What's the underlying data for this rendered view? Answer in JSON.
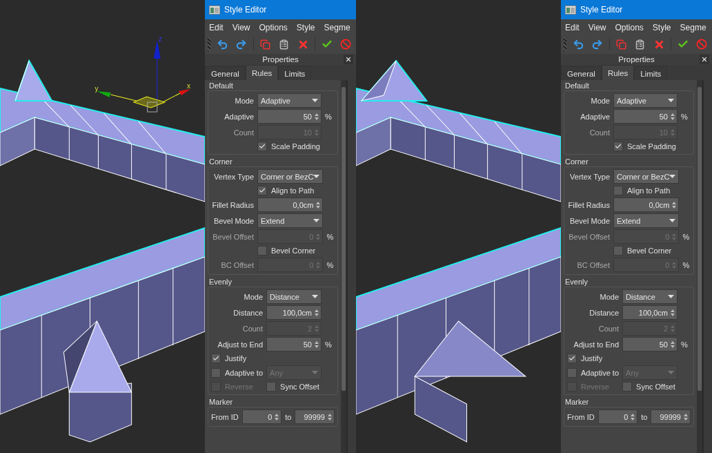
{
  "panes": [
    {
      "viewport": {
        "gizmo": {
          "axis_labels": [
            "z",
            "y",
            "x"
          ]
        }
      },
      "editor": {
        "title": "Style Editor",
        "menu": [
          "Edit",
          "View",
          "Options",
          "Style",
          "Segme"
        ],
        "properties_title": "Properties",
        "tabs": [
          {
            "label": "General",
            "selected": false
          },
          {
            "label": "Rules",
            "selected": true
          },
          {
            "label": "Limits",
            "selected": false
          }
        ],
        "sections": [
          {
            "title": "Default",
            "rows": [
              {
                "kind": "dropdown",
                "label": "Mode",
                "value": "Adaptive",
                "disabled": false
              },
              {
                "kind": "spinner",
                "label": "Adaptive",
                "value": "50",
                "unit": "%",
                "disabled": false
              },
              {
                "kind": "spinner",
                "label": "Count",
                "value": "10",
                "disabled": true
              },
              {
                "kind": "option",
                "label": "Scale Padding",
                "checked": true,
                "disabled": false
              }
            ]
          },
          {
            "title": "Corner",
            "rows": [
              {
                "kind": "dropdown",
                "label": "Vertex Type",
                "value": "Corner or BezC",
                "disabled": false
              },
              {
                "kind": "option",
                "label": "Align to Path",
                "checked": true,
                "disabled": false
              },
              {
                "kind": "spinner",
                "label": "Fillet Radius",
                "value": "0,0cm",
                "disabled": false
              },
              {
                "kind": "dropdown",
                "label": "Bevel Mode",
                "value": "Extend",
                "disabled": false
              },
              {
                "kind": "spinner",
                "label": "Bevel Offset",
                "value": "0",
                "unit": "%",
                "disabled": true
              },
              {
                "kind": "option",
                "label": "Bevel Corner",
                "checked": false,
                "disabled": false
              },
              {
                "kind": "spinner",
                "label": "BC Offset",
                "value": "0",
                "unit": "%",
                "disabled": true
              }
            ]
          },
          {
            "title": "Evenly",
            "rows": [
              {
                "kind": "dropdown",
                "label": "Mode",
                "value": "Distance",
                "disabled": false
              },
              {
                "kind": "spinner",
                "label": "Distance",
                "value": "100,0cm",
                "disabled": false
              },
              {
                "kind": "spinner",
                "label": "Count",
                "value": "2",
                "disabled": true
              },
              {
                "kind": "spinner",
                "label": "Adjust to End",
                "value": "50",
                "unit": "%",
                "disabled": false
              },
              {
                "kind": "flag",
                "label": "Justify",
                "checked": true,
                "disabled": false
              },
              {
                "kind": "flag_dropdown",
                "label": "Adaptive to",
                "checked": false,
                "disabled": false,
                "dropdown": {
                  "value": "Any",
                  "disabled": true
                }
              },
              {
                "kind": "flag_pair",
                "items": [
                  {
                    "label": "Reverse",
                    "checked": false,
                    "disabled": true
                  },
                  {
                    "label": "Sync Offset",
                    "checked": false,
                    "disabled": false
                  }
                ]
              }
            ]
          },
          {
            "title": "Marker",
            "rows": [
              {
                "kind": "range",
                "label": "From ID",
                "value": "0",
                "separator": "to",
                "value_to": "99999"
              }
            ]
          }
        ]
      }
    },
    {
      "editor": {
        "title": "Style Editor",
        "menu": [
          "Edit",
          "View",
          "Options",
          "Style",
          "Segme"
        ],
        "properties_title": "Properties",
        "tabs": [
          {
            "label": "General",
            "selected": false
          },
          {
            "label": "Rules",
            "selected": true
          },
          {
            "label": "Limits",
            "selected": false
          }
        ],
        "sections": [
          {
            "title": "Default",
            "rows": [
              {
                "kind": "dropdown",
                "label": "Mode",
                "value": "Adaptive",
                "disabled": false
              },
              {
                "kind": "spinner",
                "label": "Adaptive",
                "value": "50",
                "unit": "%",
                "disabled": false
              },
              {
                "kind": "spinner",
                "label": "Count",
                "value": "10",
                "disabled": true
              },
              {
                "kind": "option",
                "label": "Scale Padding",
                "checked": true,
                "disabled": false
              }
            ]
          },
          {
            "title": "Corner",
            "rows": [
              {
                "kind": "dropdown",
                "label": "Vertex Type",
                "value": "Corner or BezC",
                "disabled": false
              },
              {
                "kind": "option",
                "label": "Align to Path",
                "checked": false,
                "disabled": false
              },
              {
                "kind": "spinner",
                "label": "Fillet Radius",
                "value": "0,0cm",
                "disabled": false
              },
              {
                "kind": "dropdown",
                "label": "Bevel Mode",
                "value": "Extend",
                "disabled": false
              },
              {
                "kind": "spinner",
                "label": "Bevel Offset",
                "value": "0",
                "unit": "%",
                "disabled": true
              },
              {
                "kind": "option",
                "label": "Bevel Corner",
                "checked": false,
                "disabled": false
              },
              {
                "kind": "spinner",
                "label": "BC Offset",
                "value": "0",
                "unit": "%",
                "disabled": true
              }
            ]
          },
          {
            "title": "Evenly",
            "rows": [
              {
                "kind": "dropdown",
                "label": "Mode",
                "value": "Distance",
                "disabled": false
              },
              {
                "kind": "spinner",
                "label": "Distance",
                "value": "100,0cm",
                "disabled": false
              },
              {
                "kind": "spinner",
                "label": "Count",
                "value": "2",
                "disabled": true
              },
              {
                "kind": "spinner",
                "label": "Adjust to End",
                "value": "50",
                "unit": "%",
                "disabled": false
              },
              {
                "kind": "flag",
                "label": "Justify",
                "checked": true,
                "disabled": false
              },
              {
                "kind": "flag_dropdown",
                "label": "Adaptive to",
                "checked": false,
                "disabled": false,
                "dropdown": {
                  "value": "Any",
                  "disabled": true
                }
              },
              {
                "kind": "flag_pair",
                "items": [
                  {
                    "label": "Reverse",
                    "checked": false,
                    "disabled": true
                  },
                  {
                    "label": "Sync Offset",
                    "checked": false,
                    "disabled": false
                  }
                ]
              }
            ]
          },
          {
            "title": "Marker",
            "rows": [
              {
                "kind": "range",
                "label": "From ID",
                "value": "0",
                "separator": "to",
                "value_to": "99999"
              }
            ]
          }
        ]
      }
    }
  ]
}
